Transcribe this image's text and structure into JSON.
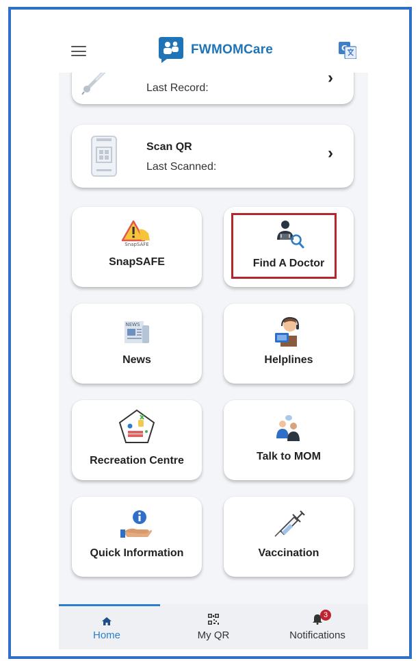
{
  "app": {
    "title": "FWMOMCare"
  },
  "records_card": {
    "subtitle": "Last Record:"
  },
  "scan_card": {
    "title": "Scan QR",
    "subtitle": "Last Scanned:"
  },
  "tiles": [
    {
      "label": "SnapSAFE",
      "icon": "warning-sign-icon",
      "icon_text": "SnapSAFE"
    },
    {
      "label": "Find A Doctor",
      "icon": "find-doctor-icon"
    },
    {
      "label": "News",
      "icon": "newspaper-icon",
      "icon_text": "NEWS"
    },
    {
      "label": "Helplines",
      "icon": "helpline-agent-icon"
    },
    {
      "label": "Recreation Centre",
      "icon": "recreation-centre-icon"
    },
    {
      "label": "Talk to MOM",
      "icon": "talk-people-icon"
    },
    {
      "label": "Quick Information",
      "icon": "info-hand-icon"
    },
    {
      "label": "Vaccination",
      "icon": "syringe-icon"
    }
  ],
  "bottom_nav": {
    "items": [
      {
        "label": "Home",
        "icon": "home-icon",
        "active": true
      },
      {
        "label": "My QR",
        "icon": "qr-icon"
      },
      {
        "label": "Notifications",
        "icon": "bell-icon",
        "badge": "3"
      }
    ]
  },
  "colors": {
    "accent": "#1f74b8",
    "highlight": "#b3262c",
    "frame": "#2f6fc8",
    "badge": "#c0232f"
  }
}
